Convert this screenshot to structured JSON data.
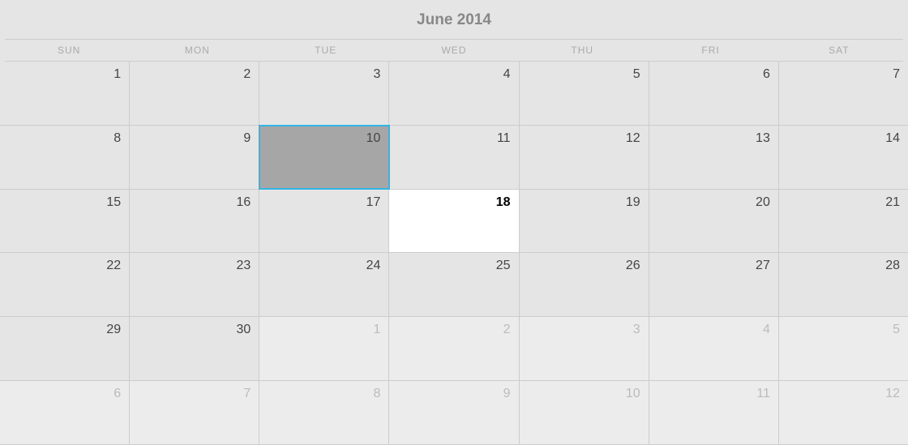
{
  "title": "June 2014",
  "day_headers": [
    "SUN",
    "MON",
    "TUE",
    "WED",
    "THU",
    "FRI",
    "SAT"
  ],
  "weeks": [
    [
      {
        "num": "1",
        "other": false,
        "today": false,
        "selected": false
      },
      {
        "num": "2",
        "other": false,
        "today": false,
        "selected": false
      },
      {
        "num": "3",
        "other": false,
        "today": false,
        "selected": false
      },
      {
        "num": "4",
        "other": false,
        "today": false,
        "selected": false
      },
      {
        "num": "5",
        "other": false,
        "today": false,
        "selected": false
      },
      {
        "num": "6",
        "other": false,
        "today": false,
        "selected": false
      },
      {
        "num": "7",
        "other": false,
        "today": false,
        "selected": false
      }
    ],
    [
      {
        "num": "8",
        "other": false,
        "today": false,
        "selected": false
      },
      {
        "num": "9",
        "other": false,
        "today": false,
        "selected": false
      },
      {
        "num": "10",
        "other": false,
        "today": false,
        "selected": true
      },
      {
        "num": "11",
        "other": false,
        "today": false,
        "selected": false
      },
      {
        "num": "12",
        "other": false,
        "today": false,
        "selected": false
      },
      {
        "num": "13",
        "other": false,
        "today": false,
        "selected": false
      },
      {
        "num": "14",
        "other": false,
        "today": false,
        "selected": false
      }
    ],
    [
      {
        "num": "15",
        "other": false,
        "today": false,
        "selected": false
      },
      {
        "num": "16",
        "other": false,
        "today": false,
        "selected": false
      },
      {
        "num": "17",
        "other": false,
        "today": false,
        "selected": false
      },
      {
        "num": "18",
        "other": false,
        "today": true,
        "selected": false
      },
      {
        "num": "19",
        "other": false,
        "today": false,
        "selected": false
      },
      {
        "num": "20",
        "other": false,
        "today": false,
        "selected": false
      },
      {
        "num": "21",
        "other": false,
        "today": false,
        "selected": false
      }
    ],
    [
      {
        "num": "22",
        "other": false,
        "today": false,
        "selected": false
      },
      {
        "num": "23",
        "other": false,
        "today": false,
        "selected": false
      },
      {
        "num": "24",
        "other": false,
        "today": false,
        "selected": false
      },
      {
        "num": "25",
        "other": false,
        "today": false,
        "selected": false
      },
      {
        "num": "26",
        "other": false,
        "today": false,
        "selected": false
      },
      {
        "num": "27",
        "other": false,
        "today": false,
        "selected": false
      },
      {
        "num": "28",
        "other": false,
        "today": false,
        "selected": false
      }
    ],
    [
      {
        "num": "29",
        "other": false,
        "today": false,
        "selected": false
      },
      {
        "num": "30",
        "other": false,
        "today": false,
        "selected": false
      },
      {
        "num": "1",
        "other": true,
        "today": false,
        "selected": false
      },
      {
        "num": "2",
        "other": true,
        "today": false,
        "selected": false
      },
      {
        "num": "3",
        "other": true,
        "today": false,
        "selected": false
      },
      {
        "num": "4",
        "other": true,
        "today": false,
        "selected": false
      },
      {
        "num": "5",
        "other": true,
        "today": false,
        "selected": false
      }
    ],
    [
      {
        "num": "6",
        "other": true,
        "today": false,
        "selected": false
      },
      {
        "num": "7",
        "other": true,
        "today": false,
        "selected": false
      },
      {
        "num": "8",
        "other": true,
        "today": false,
        "selected": false
      },
      {
        "num": "9",
        "other": true,
        "today": false,
        "selected": false
      },
      {
        "num": "10",
        "other": true,
        "today": false,
        "selected": false
      },
      {
        "num": "11",
        "other": true,
        "today": false,
        "selected": false
      },
      {
        "num": "12",
        "other": true,
        "today": false,
        "selected": false
      }
    ]
  ]
}
